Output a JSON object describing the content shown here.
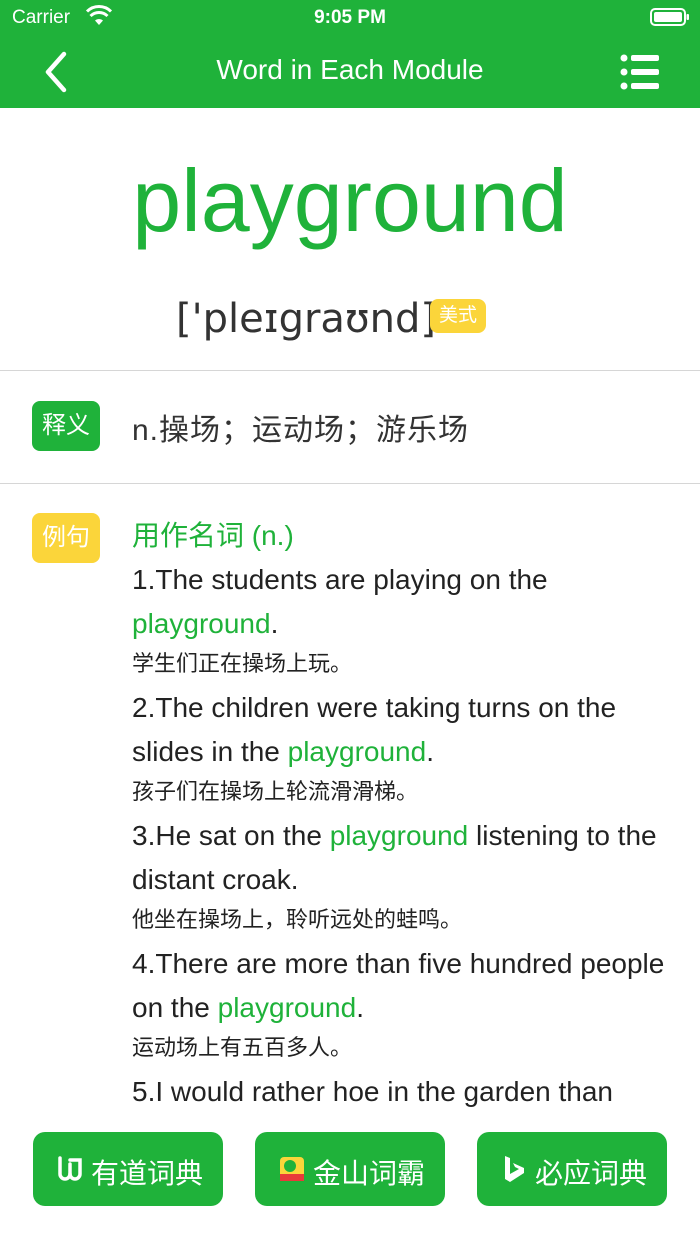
{
  "status_bar": {
    "carrier": "Carrier",
    "time": "9:05 PM"
  },
  "nav": {
    "title": "Word in Each Module"
  },
  "word": {
    "text": "playground",
    "phonetic": "['pleɪgraʊnd]",
    "accent_badge": "美式"
  },
  "meaning": {
    "tag": "释义",
    "text": "n.操场；运动场；游乐场"
  },
  "examples": {
    "tag": "例句",
    "heading": "用作名词 (n.)",
    "items": [
      {
        "en_pre": "1.The students are playing on the ",
        "en_hl": "playground",
        "en_post": ".",
        "zh": "学生们正在操场上玩。"
      },
      {
        "en_pre": "2.The children were taking turns on the slides in the ",
        "en_hl": "playground",
        "en_post": ".",
        "zh": "孩子们在操场上轮流滑滑梯。"
      },
      {
        "en_pre": "3.He sat on the ",
        "en_hl": "playground",
        "en_post": " listening to the distant croak.",
        "zh": "他坐在操场上，聆听远处的蛙鸣。"
      },
      {
        "en_pre": "4.There are more than five hundred people on the ",
        "en_hl": "playground",
        "en_post": ".",
        "zh": "运动场上有五百多人。"
      },
      {
        "en_pre": "5.I would rather hoe in the garden than",
        "en_hl": "",
        "en_post": "",
        "zh": ""
      }
    ]
  },
  "dict_buttons": [
    {
      "label": "有道词典",
      "icon": "youdao-icon"
    },
    {
      "label": "金山词霸",
      "icon": "iciba-icon"
    },
    {
      "label": "必应词典",
      "icon": "bing-icon"
    }
  ],
  "colors": {
    "accent": "#1fb23a",
    "badge": "#fbd53a"
  }
}
